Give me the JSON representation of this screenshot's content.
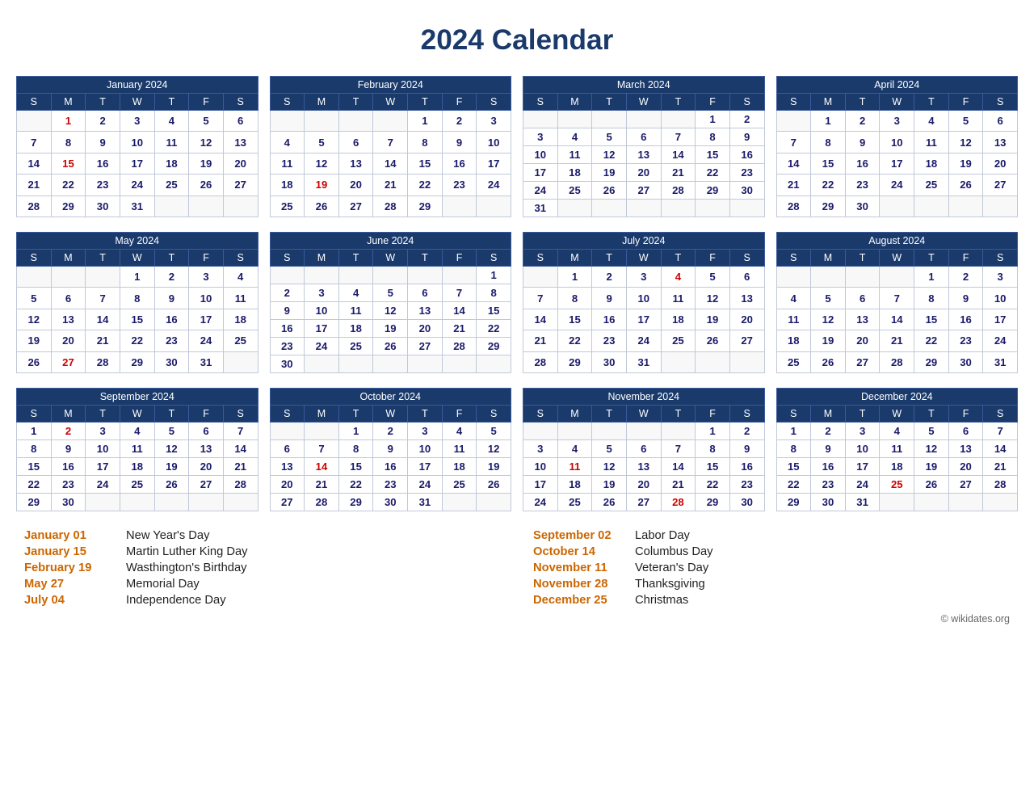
{
  "title": "2024 Calendar",
  "months": [
    {
      "name": "January 2024",
      "days_header": [
        "S",
        "M",
        "T",
        "W",
        "T",
        "F",
        "S"
      ],
      "weeks": [
        [
          "",
          "1",
          "2",
          "3",
          "4",
          "5",
          "6"
        ],
        [
          "7",
          "8",
          "9",
          "10",
          "11",
          "12",
          "13"
        ],
        [
          "14",
          "15",
          "16",
          "17",
          "18",
          "19",
          "20"
        ],
        [
          "21",
          "22",
          "23",
          "24",
          "25",
          "26",
          "27"
        ],
        [
          "28",
          "29",
          "30",
          "31",
          "",
          "",
          ""
        ]
      ],
      "holidays": [
        "1",
        "15"
      ]
    },
    {
      "name": "February 2024",
      "days_header": [
        "S",
        "M",
        "T",
        "W",
        "T",
        "F",
        "S"
      ],
      "weeks": [
        [
          "",
          "",
          "",
          "",
          "1",
          "2",
          "3"
        ],
        [
          "4",
          "5",
          "6",
          "7",
          "8",
          "9",
          "10"
        ],
        [
          "11",
          "12",
          "13",
          "14",
          "15",
          "16",
          "17"
        ],
        [
          "18",
          "19",
          "20",
          "21",
          "22",
          "23",
          "24"
        ],
        [
          "25",
          "26",
          "27",
          "28",
          "29",
          "",
          ""
        ]
      ],
      "holidays": [
        "19"
      ]
    },
    {
      "name": "March 2024",
      "days_header": [
        "S",
        "M",
        "T",
        "W",
        "T",
        "F",
        "S"
      ],
      "weeks": [
        [
          "",
          "",
          "",
          "",
          "",
          "1",
          "2"
        ],
        [
          "3",
          "4",
          "5",
          "6",
          "7",
          "8",
          "9"
        ],
        [
          "10",
          "11",
          "12",
          "13",
          "14",
          "15",
          "16"
        ],
        [
          "17",
          "18",
          "19",
          "20",
          "21",
          "22",
          "23"
        ],
        [
          "24",
          "25",
          "26",
          "27",
          "28",
          "29",
          "30"
        ],
        [
          "31",
          "",
          "",
          "",
          "",
          "",
          ""
        ]
      ],
      "holidays": []
    },
    {
      "name": "April 2024",
      "days_header": [
        "S",
        "M",
        "T",
        "W",
        "T",
        "F",
        "S"
      ],
      "weeks": [
        [
          "",
          "1",
          "2",
          "3",
          "4",
          "5",
          "6"
        ],
        [
          "7",
          "8",
          "9",
          "10",
          "11",
          "12",
          "13"
        ],
        [
          "14",
          "15",
          "16",
          "17",
          "18",
          "19",
          "20"
        ],
        [
          "21",
          "22",
          "23",
          "24",
          "25",
          "26",
          "27"
        ],
        [
          "28",
          "29",
          "30",
          "",
          "",
          "",
          ""
        ]
      ],
      "holidays": []
    },
    {
      "name": "May 2024",
      "days_header": [
        "S",
        "M",
        "T",
        "W",
        "T",
        "F",
        "S"
      ],
      "weeks": [
        [
          "",
          "",
          "",
          "1",
          "2",
          "3",
          "4"
        ],
        [
          "5",
          "6",
          "7",
          "8",
          "9",
          "10",
          "11"
        ],
        [
          "12",
          "13",
          "14",
          "15",
          "16",
          "17",
          "18"
        ],
        [
          "19",
          "20",
          "21",
          "22",
          "23",
          "24",
          "25"
        ],
        [
          "26",
          "27",
          "28",
          "29",
          "30",
          "31",
          ""
        ]
      ],
      "holidays": [
        "27"
      ]
    },
    {
      "name": "June 2024",
      "days_header": [
        "S",
        "M",
        "T",
        "W",
        "T",
        "F",
        "S"
      ],
      "weeks": [
        [
          "",
          "",
          "",
          "",
          "",
          "",
          "1"
        ],
        [
          "2",
          "3",
          "4",
          "5",
          "6",
          "7",
          "8"
        ],
        [
          "9",
          "10",
          "11",
          "12",
          "13",
          "14",
          "15"
        ],
        [
          "16",
          "17",
          "18",
          "19",
          "20",
          "21",
          "22"
        ],
        [
          "23",
          "24",
          "25",
          "26",
          "27",
          "28",
          "29"
        ],
        [
          "30",
          "",
          "",
          "",
          "",
          "",
          ""
        ]
      ],
      "holidays": []
    },
    {
      "name": "July 2024",
      "days_header": [
        "S",
        "M",
        "T",
        "W",
        "T",
        "F",
        "S"
      ],
      "weeks": [
        [
          "",
          "1",
          "2",
          "3",
          "4",
          "5",
          "6"
        ],
        [
          "7",
          "8",
          "9",
          "10",
          "11",
          "12",
          "13"
        ],
        [
          "14",
          "15",
          "16",
          "17",
          "18",
          "19",
          "20"
        ],
        [
          "21",
          "22",
          "23",
          "24",
          "25",
          "26",
          "27"
        ],
        [
          "28",
          "29",
          "30",
          "31",
          "",
          "",
          ""
        ]
      ],
      "holidays": [
        "4"
      ]
    },
    {
      "name": "August 2024",
      "days_header": [
        "S",
        "M",
        "T",
        "W",
        "T",
        "F",
        "S"
      ],
      "weeks": [
        [
          "",
          "",
          "",
          "",
          "1",
          "2",
          "3"
        ],
        [
          "4",
          "5",
          "6",
          "7",
          "8",
          "9",
          "10"
        ],
        [
          "11",
          "12",
          "13",
          "14",
          "15",
          "16",
          "17"
        ],
        [
          "18",
          "19",
          "20",
          "21",
          "22",
          "23",
          "24"
        ],
        [
          "25",
          "26",
          "27",
          "28",
          "29",
          "30",
          "31"
        ]
      ],
      "holidays": []
    },
    {
      "name": "September 2024",
      "days_header": [
        "S",
        "M",
        "T",
        "W",
        "T",
        "F",
        "S"
      ],
      "weeks": [
        [
          "1",
          "2",
          "3",
          "4",
          "5",
          "6",
          "7"
        ],
        [
          "8",
          "9",
          "10",
          "11",
          "12",
          "13",
          "14"
        ],
        [
          "15",
          "16",
          "17",
          "18",
          "19",
          "20",
          "21"
        ],
        [
          "22",
          "23",
          "24",
          "25",
          "26",
          "27",
          "28"
        ],
        [
          "29",
          "30",
          "",
          "",
          "",
          "",
          ""
        ]
      ],
      "holidays": [
        "2"
      ]
    },
    {
      "name": "October 2024",
      "days_header": [
        "S",
        "M",
        "T",
        "W",
        "T",
        "F",
        "S"
      ],
      "weeks": [
        [
          "",
          "",
          "1",
          "2",
          "3",
          "4",
          "5"
        ],
        [
          "6",
          "7",
          "8",
          "9",
          "10",
          "11",
          "12"
        ],
        [
          "13",
          "14",
          "15",
          "16",
          "17",
          "18",
          "19"
        ],
        [
          "20",
          "21",
          "22",
          "23",
          "24",
          "25",
          "26"
        ],
        [
          "27",
          "28",
          "29",
          "30",
          "31",
          "",
          ""
        ]
      ],
      "holidays": [
        "14"
      ]
    },
    {
      "name": "November 2024",
      "days_header": [
        "S",
        "M",
        "T",
        "W",
        "T",
        "F",
        "S"
      ],
      "weeks": [
        [
          "",
          "",
          "",
          "",
          "",
          "1",
          "2"
        ],
        [
          "3",
          "4",
          "5",
          "6",
          "7",
          "8",
          "9"
        ],
        [
          "10",
          "11",
          "12",
          "13",
          "14",
          "15",
          "16"
        ],
        [
          "17",
          "18",
          "19",
          "20",
          "21",
          "22",
          "23"
        ],
        [
          "24",
          "25",
          "26",
          "27",
          "28",
          "29",
          "30"
        ]
      ],
      "holidays": [
        "11",
        "28"
      ]
    },
    {
      "name": "December 2024",
      "days_header": [
        "S",
        "M",
        "T",
        "W",
        "T",
        "F",
        "S"
      ],
      "weeks": [
        [
          "1",
          "2",
          "3",
          "4",
          "5",
          "6",
          "7"
        ],
        [
          "8",
          "9",
          "10",
          "11",
          "12",
          "13",
          "14"
        ],
        [
          "15",
          "16",
          "17",
          "18",
          "19",
          "20",
          "21"
        ],
        [
          "22",
          "23",
          "24",
          "25",
          "26",
          "27",
          "28"
        ],
        [
          "29",
          "30",
          "31",
          "",
          "",
          "",
          ""
        ]
      ],
      "holidays": [
        "25"
      ]
    }
  ],
  "holidays_list": [
    {
      "date": "January 01",
      "name": "New Year's Day"
    },
    {
      "date": "January 15",
      "name": "Martin Luther King Day"
    },
    {
      "date": "February 19",
      "name": "Wasthington's Birthday"
    },
    {
      "date": "May 27",
      "name": "Memorial Day"
    },
    {
      "date": "July 04",
      "name": "Independence Day"
    },
    {
      "date": "September 02",
      "name": "Labor Day"
    },
    {
      "date": "October 14",
      "name": "Columbus Day"
    },
    {
      "date": "November 11",
      "name": "Veteran's Day"
    },
    {
      "date": "November 28",
      "name": "Thanksgiving"
    },
    {
      "date": "December 25",
      "name": "Christmas"
    }
  ],
  "copyright": "© wikidates.org"
}
